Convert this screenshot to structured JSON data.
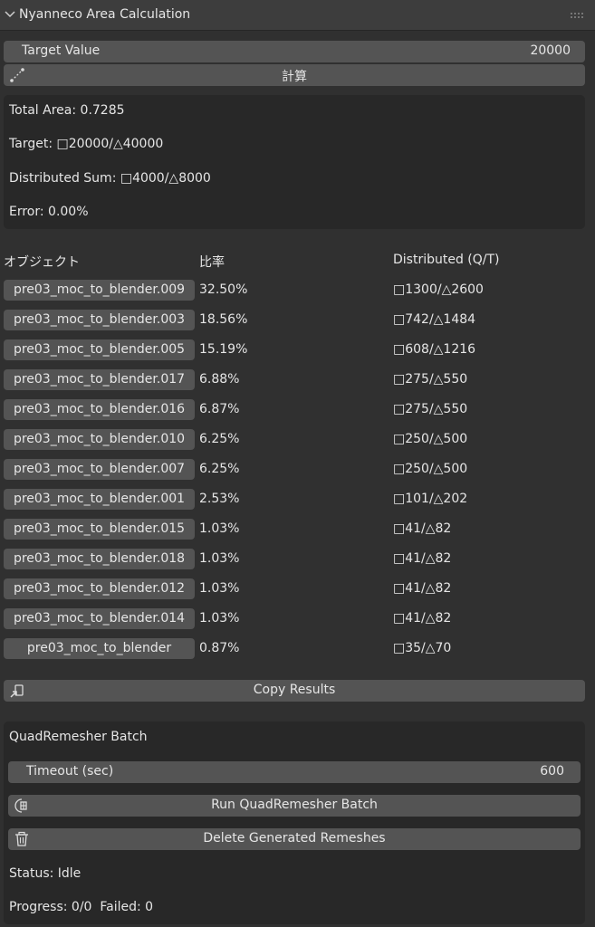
{
  "panel": {
    "title": "Nyanneco Area Calculation"
  },
  "target": {
    "label": "Target Value",
    "value": "20000"
  },
  "calc_button": {
    "label": "計算"
  },
  "summary": {
    "total_area": "Total Area: 0.7285",
    "target": "Target: □20000/△40000",
    "distributed_sum": "Distributed Sum: □4000/△8000",
    "error": "Error: 0.00%"
  },
  "table": {
    "headers": {
      "object": "オブジェクト",
      "ratio": "比率",
      "distributed": "Distributed (Q/T)"
    },
    "rows": [
      {
        "name": "pre03_moc_to_blender.009",
        "ratio": "32.50%",
        "dist": "□1300/△2600"
      },
      {
        "name": "pre03_moc_to_blender.003",
        "ratio": "18.56%",
        "dist": "□742/△1484"
      },
      {
        "name": "pre03_moc_to_blender.005",
        "ratio": "15.19%",
        "dist": "□608/△1216"
      },
      {
        "name": "pre03_moc_to_blender.017",
        "ratio": "6.88%",
        "dist": "□275/△550"
      },
      {
        "name": "pre03_moc_to_blender.016",
        "ratio": "6.87%",
        "dist": "□275/△550"
      },
      {
        "name": "pre03_moc_to_blender.010",
        "ratio": "6.25%",
        "dist": "□250/△500"
      },
      {
        "name": "pre03_moc_to_blender.007",
        "ratio": "6.25%",
        "dist": "□250/△500"
      },
      {
        "name": "pre03_moc_to_blender.001",
        "ratio": "2.53%",
        "dist": "□101/△202"
      },
      {
        "name": "pre03_moc_to_blender.015",
        "ratio": "1.03%",
        "dist": "□41/△82"
      },
      {
        "name": "pre03_moc_to_blender.018",
        "ratio": "1.03%",
        "dist": "□41/△82"
      },
      {
        "name": "pre03_moc_to_blender.012",
        "ratio": "1.03%",
        "dist": "□41/△82"
      },
      {
        "name": "pre03_moc_to_blender.014",
        "ratio": "1.03%",
        "dist": "□41/△82"
      },
      {
        "name": "pre03_moc_to_blender",
        "ratio": "0.87%",
        "dist": "□35/△70"
      }
    ]
  },
  "copy_button": {
    "label": "Copy Results"
  },
  "quadremesher": {
    "title": "QuadRemesher Batch",
    "timeout_label": "Timeout (sec)",
    "timeout_value": "600",
    "run_label": "Run QuadRemesher Batch",
    "delete_label": "Delete Generated Remeshes",
    "status": "Status: Idle",
    "progress": "Progress: 0/0  Failed: 0"
  }
}
